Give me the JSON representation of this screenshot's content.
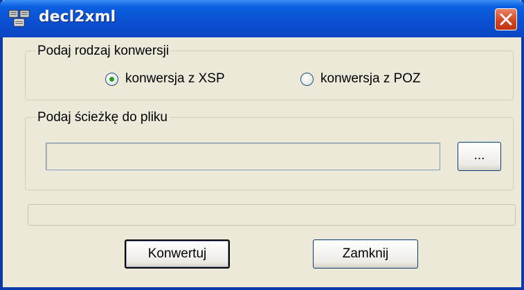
{
  "window": {
    "title": "decl2xml"
  },
  "conversion_group": {
    "label": "Podaj rodzaj konwersji",
    "options": [
      {
        "label": "konwersja z XSP",
        "checked": true
      },
      {
        "label": "konwersja z POZ",
        "checked": false
      }
    ]
  },
  "path_group": {
    "label": "Podaj ścieżkę do pliku",
    "path_value": "",
    "browse_label": "..."
  },
  "progress": {
    "value": 0
  },
  "buttons": {
    "convert": "Konwertuj",
    "close": "Zamknij"
  }
}
